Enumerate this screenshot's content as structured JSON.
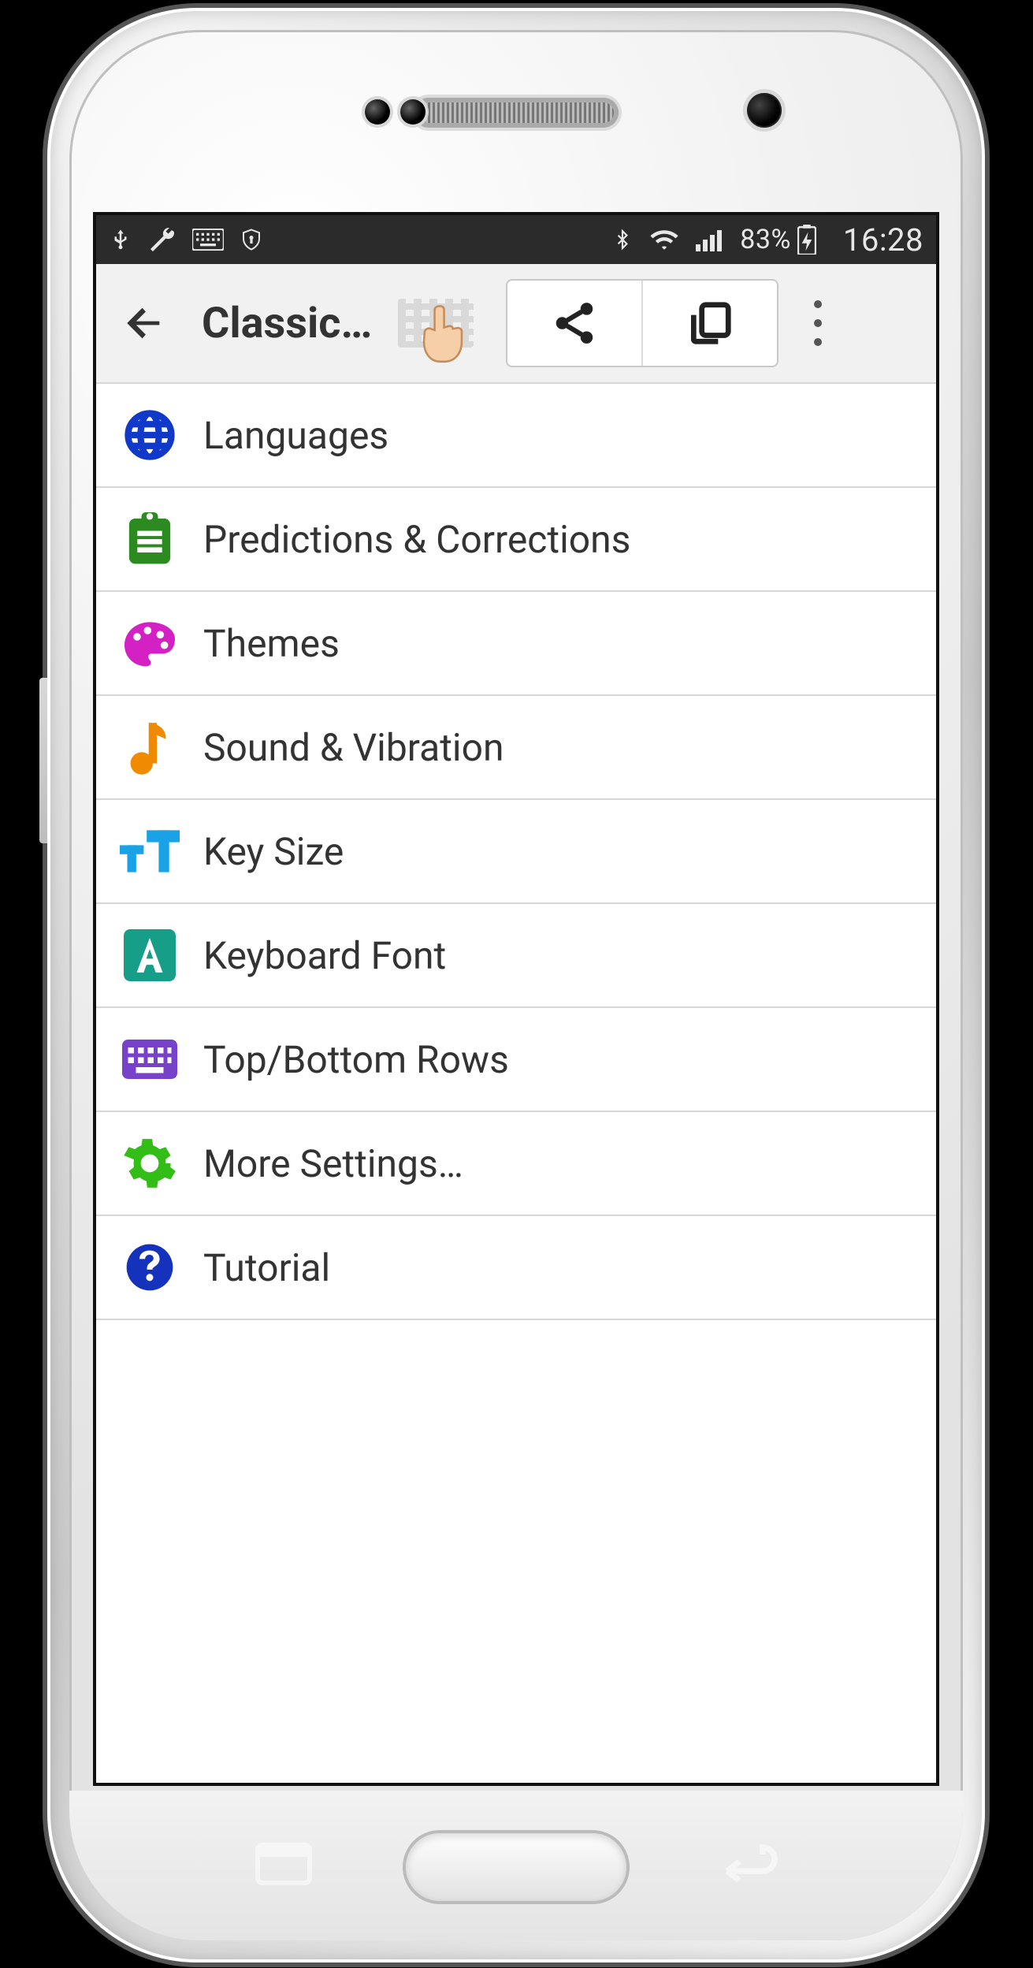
{
  "status": {
    "battery_pct": "83%",
    "clock": "16:28"
  },
  "actionbar": {
    "title": "Classic…"
  },
  "settings": {
    "items": [
      {
        "label": "Languages"
      },
      {
        "label": "Predictions & Corrections"
      },
      {
        "label": "Themes"
      },
      {
        "label": "Sound & Vibration"
      },
      {
        "label": "Key Size"
      },
      {
        "label": "Keyboard Font"
      },
      {
        "label": "Top/Bottom Rows"
      },
      {
        "label": "More Settings…"
      },
      {
        "label": "Tutorial"
      }
    ]
  }
}
